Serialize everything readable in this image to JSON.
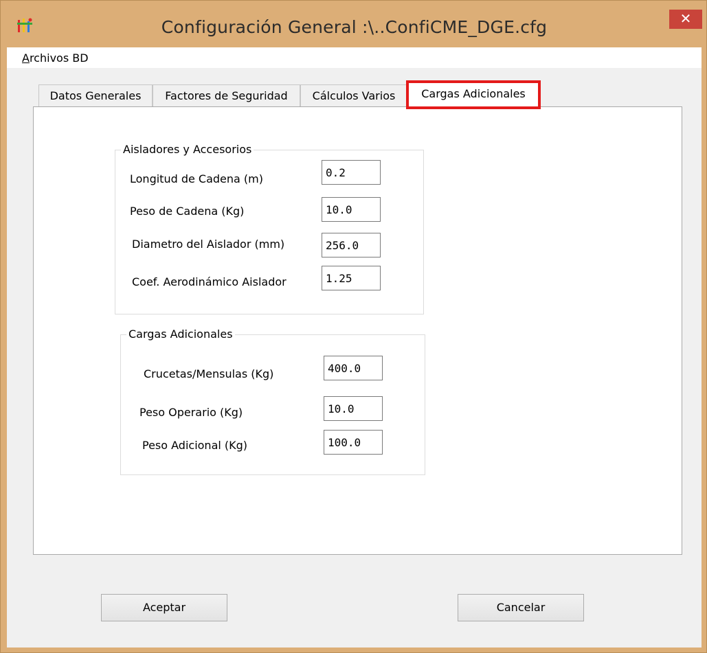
{
  "window": {
    "title": "Configuración General :\\..ConfiCME_DGE.cfg",
    "close_glyph": "✕"
  },
  "menu": {
    "archivos_accel": "A",
    "archivos_rest": "rchivos BD"
  },
  "tabs": [
    {
      "label": "Datos Generales",
      "active": false
    },
    {
      "label": "Factores de Seguridad",
      "active": false
    },
    {
      "label": "Cálculos Varios",
      "active": false
    },
    {
      "label": "Cargas Adicionales",
      "active": true
    }
  ],
  "group_aisladores": {
    "title": "Aisladores y Accesorios",
    "fields": [
      {
        "label": "Longitud de Cadena (m)",
        "value": "0.2"
      },
      {
        "label": "Peso de Cadena (Kg)",
        "value": "10.0"
      },
      {
        "label": "Diametro del Aislador (mm)",
        "value": "256.0"
      },
      {
        "label": "Coef.  Aerodinámico  Aislador",
        "value": "1.25"
      }
    ]
  },
  "group_cargas": {
    "title": "Cargas Adicionales",
    "fields": [
      {
        "label": "Crucetas/Mensulas (Kg)",
        "value": "400.0"
      },
      {
        "label": "Peso Operario (Kg)",
        "value": "10.0"
      },
      {
        "label": "Peso Adicional (Kg)",
        "value": "100.0"
      }
    ]
  },
  "buttons": {
    "accept": "Aceptar",
    "cancel": "Cancelar"
  },
  "colors": {
    "frame": "#dcae77",
    "close_bg": "#c9443a",
    "highlight": "#e41a1a"
  }
}
